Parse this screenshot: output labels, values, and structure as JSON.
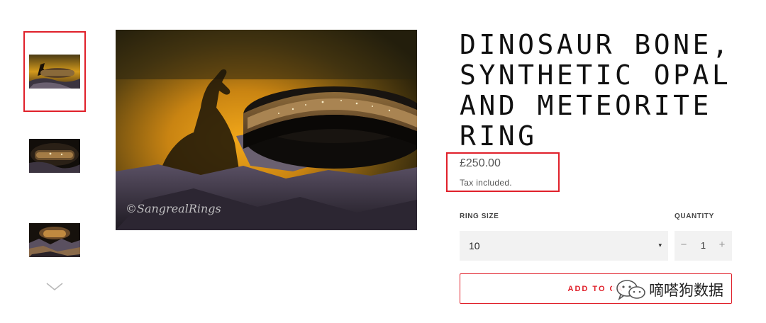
{
  "product": {
    "title": "DINOSAUR BONE, SYNTHETIC OPAL AND METEORITE RING",
    "price": "£250.00",
    "tax_note": "Tax included.",
    "image_watermark": "©SangrealRings"
  },
  "gallery": {
    "thumbnails": [
      {
        "name": "thumbnail-1",
        "selected": true
      },
      {
        "name": "thumbnail-2",
        "selected": false
      },
      {
        "name": "thumbnail-3",
        "selected": false
      }
    ],
    "scroll_icon": "chevron-down-icon"
  },
  "ring_size": {
    "label": "RING SIZE",
    "value": "10",
    "caret": "▾"
  },
  "quantity": {
    "label": "QUANTITY",
    "minus": "−",
    "value": "1",
    "plus": "+"
  },
  "add_to_cart": {
    "label": "ADD TO CA"
  },
  "overlay": {
    "text": "嘀嗒狗数据",
    "icon": "wechat-icon"
  },
  "colors": {
    "highlight_border": "#e0202a",
    "add_to_cart_accent": "#e0202a",
    "field_background": "#f2f2f2"
  }
}
